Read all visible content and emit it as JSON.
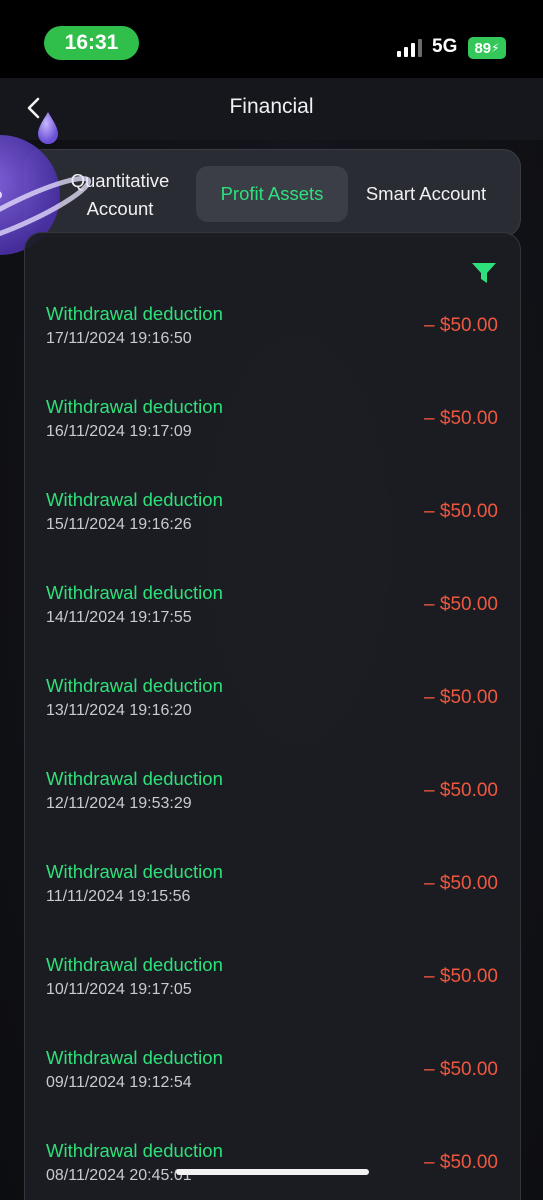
{
  "status_bar": {
    "time": "16:31",
    "network": "5G",
    "battery": "89",
    "signal_icon": "signal-bars-icon"
  },
  "header": {
    "title": "Financial",
    "back_icon": "chevron-left-icon"
  },
  "tabs": [
    {
      "label_line1": "Quantitative",
      "label_line2": "Account",
      "active": false
    },
    {
      "label": "Profit Assets",
      "active": true
    },
    {
      "label": "Smart Account",
      "active": false
    }
  ],
  "colors": {
    "accent_green": "#2ee07a",
    "amount_red": "#f0573f",
    "status_green": "#2fbf4a"
  },
  "filter_icon": "filter-funnel-icon",
  "transactions": [
    {
      "title": "Withdrawal deduction",
      "date": "17/11/2024 19:16:50",
      "amount": "– $50.00"
    },
    {
      "title": "Withdrawal deduction",
      "date": "16/11/2024 19:17:09",
      "amount": "– $50.00"
    },
    {
      "title": "Withdrawal deduction",
      "date": "15/11/2024 19:16:26",
      "amount": "– $50.00"
    },
    {
      "title": "Withdrawal deduction",
      "date": "14/11/2024 19:17:55",
      "amount": "– $50.00"
    },
    {
      "title": "Withdrawal deduction",
      "date": "13/11/2024 19:16:20",
      "amount": "– $50.00"
    },
    {
      "title": "Withdrawal deduction",
      "date": "12/11/2024 19:53:29",
      "amount": "– $50.00"
    },
    {
      "title": "Withdrawal deduction",
      "date": "11/11/2024 19:15:56",
      "amount": "– $50.00"
    },
    {
      "title": "Withdrawal deduction",
      "date": "10/11/2024 19:17:05",
      "amount": "– $50.00"
    },
    {
      "title": "Withdrawal deduction",
      "date": "09/11/2024 19:12:54",
      "amount": "– $50.00"
    },
    {
      "title": "Withdrawal deduction",
      "date": "08/11/2024 20:45:01",
      "amount": "– $50.00"
    }
  ]
}
